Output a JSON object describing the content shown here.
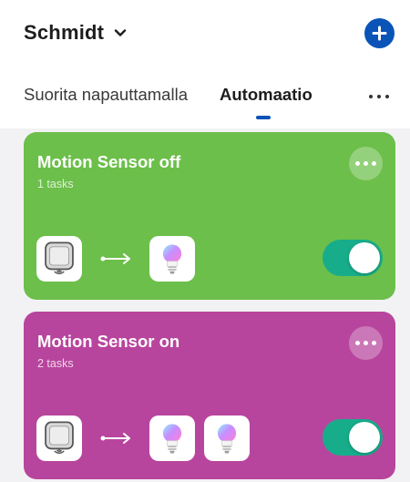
{
  "header": {
    "home_name": "Schmidt",
    "add_icon": "plus-circle-icon",
    "dropdown_icon": "chevron-down-icon"
  },
  "tabs": [
    {
      "label": "Suorita napauttamalla",
      "active": false
    },
    {
      "label": "Automaatio",
      "active": true
    }
  ],
  "more_tabs_icon": "more-horizontal-icon",
  "automations": [
    {
      "title": "Motion Sensor off",
      "subtitle": "1 tasks",
      "color": "#6cbf4a",
      "enabled": true,
      "trigger_icon": "motion-sensor-icon",
      "action_icons": [
        "smart-bulb-icon"
      ]
    },
    {
      "title": "Motion Sensor on",
      "subtitle": "2 tasks",
      "color": "#b8459d",
      "enabled": true,
      "trigger_icon": "motion-sensor-icon",
      "action_icons": [
        "smart-bulb-icon",
        "smart-bulb-icon"
      ]
    }
  ],
  "colors": {
    "accent_blue": "#0a54b8",
    "toggle_on": "#17ad8a",
    "card_green": "#6cbf4a",
    "card_magenta": "#b8459d"
  }
}
